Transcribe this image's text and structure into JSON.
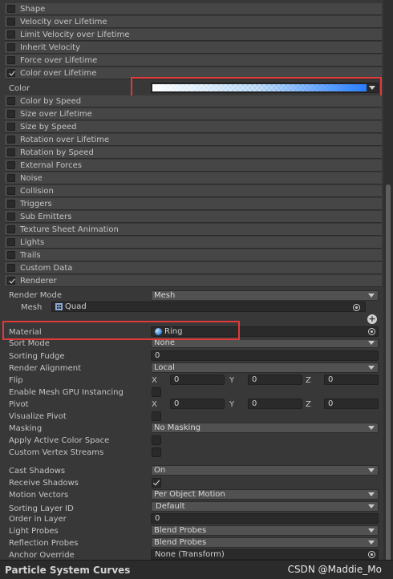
{
  "modules_top": [
    {
      "label": "Shape",
      "checked": false
    },
    {
      "label": "Velocity over Lifetime",
      "checked": false
    },
    {
      "label": "Limit Velocity over Lifetime",
      "checked": false
    },
    {
      "label": "Inherit Velocity",
      "checked": false
    },
    {
      "label": "Force over Lifetime",
      "checked": false
    },
    {
      "label": "Color over Lifetime",
      "checked": true
    }
  ],
  "color_over_lifetime": {
    "color_label": "Color"
  },
  "modules_mid": [
    {
      "label": "Color by Speed",
      "checked": false
    },
    {
      "label": "Size over Lifetime",
      "checked": false
    },
    {
      "label": "Size by Speed",
      "checked": false
    },
    {
      "label": "Rotation over Lifetime",
      "checked": false
    },
    {
      "label": "Rotation by Speed",
      "checked": false
    },
    {
      "label": "External Forces",
      "checked": false
    },
    {
      "label": "Noise",
      "checked": false
    },
    {
      "label": "Collision",
      "checked": false
    },
    {
      "label": "Triggers",
      "checked": false
    },
    {
      "label": "Sub Emitters",
      "checked": false
    },
    {
      "label": "Texture Sheet Animation",
      "checked": false
    },
    {
      "label": "Lights",
      "checked": false
    },
    {
      "label": "Trails",
      "checked": false
    },
    {
      "label": "Custom Data",
      "checked": false
    },
    {
      "label": "Renderer",
      "checked": true
    }
  ],
  "renderer": {
    "render_mode": {
      "label": "Render Mode",
      "value": "Mesh"
    },
    "mesh": {
      "label": "Mesh",
      "value": "Quad"
    },
    "material": {
      "label": "Material",
      "value": "Ring"
    },
    "sort_mode": {
      "label": "Sort Mode",
      "value": "None"
    },
    "sorting_fudge": {
      "label": "Sorting Fudge",
      "value": "0"
    },
    "render_alignment": {
      "label": "Render Alignment",
      "value": "Local"
    },
    "flip": {
      "label": "Flip",
      "x": "0",
      "y": "0",
      "z": "0"
    },
    "gpu_instancing": {
      "label": "Enable Mesh GPU Instancing",
      "checked": false
    },
    "pivot": {
      "label": "Pivot",
      "x": "0",
      "y": "0",
      "z": "0"
    },
    "visualize_pivot": {
      "label": "Visualize Pivot",
      "checked": false
    },
    "masking": {
      "label": "Masking",
      "value": "No Masking"
    },
    "apply_active_color_space": {
      "label": "Apply Active Color Space",
      "checked": false
    },
    "custom_vertex_streams": {
      "label": "Custom Vertex Streams",
      "checked": false
    },
    "cast_shadows": {
      "label": "Cast Shadows",
      "value": "On"
    },
    "receive_shadows": {
      "label": "Receive Shadows",
      "checked": true
    },
    "motion_vectors": {
      "label": "Motion Vectors",
      "value": "Per Object Motion"
    },
    "sorting_layer_id": {
      "label": "Sorting Layer ID",
      "value": "Default"
    },
    "order_in_layer": {
      "label": "Order in Layer",
      "value": "0"
    },
    "light_probes": {
      "label": "Light Probes",
      "value": "Blend Probes"
    },
    "reflection_probes": {
      "label": "Reflection Probes",
      "value": "Blend Probes"
    },
    "anchor_override": {
      "label": "Anchor Override",
      "value": "None (Transform)"
    }
  },
  "axis_labels": {
    "x": "X",
    "y": "Y",
    "z": "Z"
  },
  "bottom_bar": {
    "title": "Particle System Curves",
    "watermark": "CSDN @Maddie_Mo"
  },
  "colors": {
    "highlight": "#e03a3a",
    "background": "#383838",
    "module_row": "#464646",
    "gradient_start": "#ffffff",
    "gradient_end": "#2a7fff"
  }
}
